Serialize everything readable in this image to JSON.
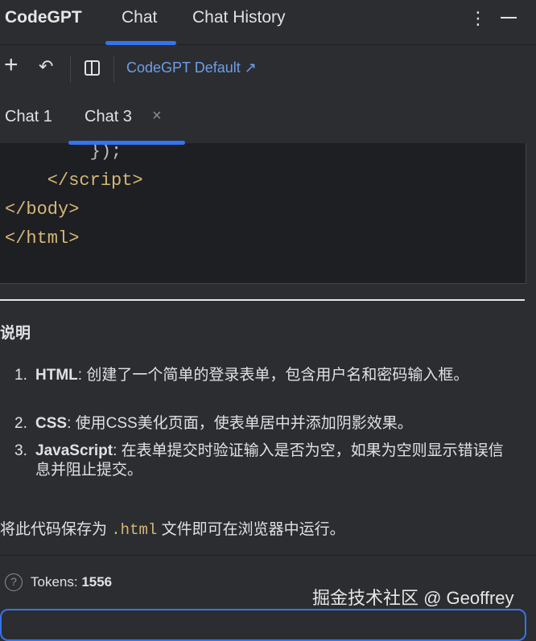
{
  "header": {
    "brand": "CodeGPT",
    "tabs": [
      "Chat",
      "Chat History"
    ]
  },
  "toolbar": {
    "model_link": "CodeGPT Default ↗"
  },
  "chat_tabs": [
    "Chat 1",
    "Chat 3"
  ],
  "code_lines": [
    "        });",
    "    </script>",
    "</body>",
    "</html>"
  ],
  "explain": {
    "heading": "说明",
    "items": [
      {
        "num": "1.",
        "term": "HTML",
        "text": ": 创建了一个简单的登录表单，包含用户名和密码输入框。"
      },
      {
        "num": "2.",
        "term": "CSS",
        "text": ": 使用CSS美化页面，使表单居中并添加阴影效果。"
      },
      {
        "num": "3.",
        "term": "JavaScript",
        "text": ": 在表单提交时验证输入是否为空，如果为空则显示错误信息并阻止提交。"
      }
    ],
    "note_pre": "将此代码保存为 ",
    "note_code": ".html",
    "note_post": " 文件即可在浏览器中运行。"
  },
  "footer": {
    "tokens_label": "Tokens: ",
    "tokens_value": "1556",
    "watermark": "掘金技术社区 @ Geoffrey"
  }
}
